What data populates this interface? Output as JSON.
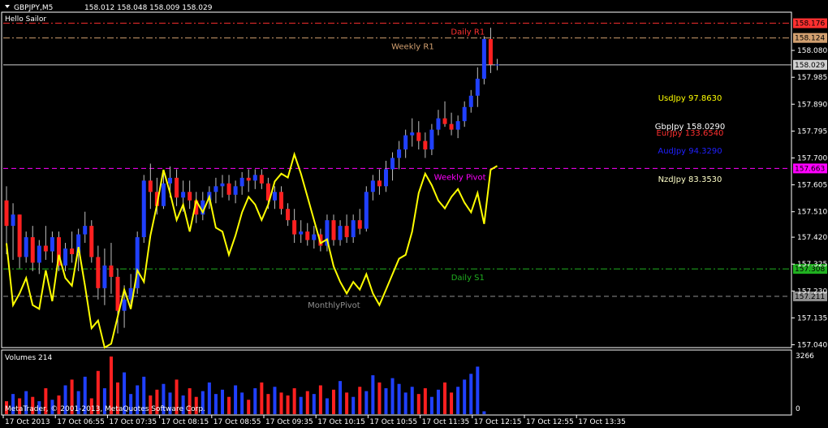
{
  "header": {
    "symbol": "GBPJPY,M5",
    "ohlc": "158.012 158.048 158.009 158.029",
    "comment": "Hello Sailor"
  },
  "volume_panel": {
    "title": "Volumes 214",
    "axis_top": "3266",
    "axis_bottom": "0",
    "copyright": "MetaTrader, © 2001-2013, MetaQuotes Software Corp."
  },
  "price_axis": {
    "ticks": [
      "158.080",
      "157.985",
      "157.890",
      "157.795",
      "157.700",
      "157.605",
      "157.510",
      "157.420",
      "157.325",
      "157.230",
      "157.135",
      "157.040"
    ],
    "ylim": [
      157.03,
      158.215
    ]
  },
  "time_axis": {
    "labels": [
      "17 Oct 2013",
      "17 Oct 06:55",
      "17 Oct 07:35",
      "17 Oct 08:15",
      "17 Oct 08:55",
      "17 Oct 09:35",
      "17 Oct 10:15",
      "17 Oct 10:55",
      "17 Oct 11:35",
      "17 Oct 12:15",
      "17 Oct 12:55",
      "17 Oct 13:35"
    ]
  },
  "levels": [
    {
      "name": "Daily R1",
      "price": 158.176,
      "label": "158.176",
      "color": "#ff3030",
      "style": "dashdot",
      "tag": "Daily R1",
      "tag_color": "#ff3030",
      "tag_pos": 0.59
    },
    {
      "name": "Weekly R1",
      "price": 158.124,
      "label": "158.124",
      "color": "#d2a070",
      "style": "dashdot",
      "tag": "Weekly R1",
      "tag_color": "#d2a070",
      "tag_pos": 0.52
    },
    {
      "name": "current",
      "price": 158.029,
      "label": "158.029",
      "color": "#d0d0d0",
      "style": "solid",
      "tag": "",
      "tag_color": "",
      "tag_pos": 0
    },
    {
      "name": "Weekly Pivot",
      "price": 157.663,
      "label": "157.663",
      "color": "#ff00ff",
      "style": "dashed",
      "tag": "Weekly Pivot",
      "tag_color": "#ff00ff",
      "tag_pos": 0.58
    },
    {
      "name": "Daily S1",
      "price": 157.308,
      "label": "157.308",
      "color": "#20b020",
      "style": "dashdot",
      "tag": "Daily S1",
      "tag_color": "#20b020",
      "tag_pos": 0.59
    },
    {
      "name": "MonthlyPivot",
      "price": 157.211,
      "label": "157.211",
      "color": "#909090",
      "style": "dashed",
      "tag": "MonthlyPivot",
      "tag_color": "#909090",
      "tag_pos": 0.42
    }
  ],
  "labels": [
    {
      "text": "UsdJpy 97.8630",
      "color": "#ffff00"
    },
    {
      "text": "GbpJpy 158.0290",
      "color": "#ffffff"
    },
    {
      "text": "EurJpy 133.6540",
      "color": "#ff3030"
    },
    {
      "text": "AudJpy 94.3290",
      "color": "#2020ff"
    },
    {
      "text": "NzdJpy 83.3530",
      "color": "#ffffc8"
    }
  ],
  "colors": {
    "bull": "#2040ff",
    "bear": "#ff2020",
    "wick": "#c0c0c0",
    "usdjpy_line": "#ffff00",
    "axis": "#ffffff"
  },
  "chart_data": {
    "type": "candlestick",
    "symbol": "GBPJPY,M5",
    "ylim": [
      157.03,
      158.215
    ],
    "candles": [
      [
        157.55,
        157.6,
        157.36,
        157.46
      ],
      [
        157.46,
        157.54,
        157.34,
        157.5
      ],
      [
        157.5,
        157.5,
        157.31,
        157.35
      ],
      [
        157.35,
        157.44,
        157.33,
        157.42
      ],
      [
        157.42,
        157.46,
        157.3,
        157.33
      ],
      [
        157.33,
        157.41,
        157.29,
        157.39
      ],
      [
        157.39,
        157.46,
        157.34,
        157.37
      ],
      [
        157.37,
        157.44,
        157.33,
        157.42
      ],
      [
        157.42,
        157.44,
        157.3,
        157.32
      ],
      [
        157.32,
        157.4,
        157.3,
        157.38
      ],
      [
        157.38,
        157.44,
        157.33,
        157.36
      ],
      [
        157.36,
        157.45,
        157.3,
        157.43
      ],
      [
        157.43,
        157.51,
        157.4,
        157.46
      ],
      [
        157.46,
        157.48,
        157.33,
        157.35
      ],
      [
        157.35,
        157.39,
        157.2,
        157.24
      ],
      [
        157.24,
        157.38,
        157.18,
        157.32
      ],
      [
        157.32,
        157.4,
        157.22,
        157.28
      ],
      [
        157.28,
        157.31,
        157.08,
        157.16
      ],
      [
        157.16,
        157.25,
        157.1,
        157.2
      ],
      [
        157.2,
        157.29,
        157.17,
        157.24
      ],
      [
        157.24,
        157.44,
        157.22,
        157.42
      ],
      [
        157.42,
        157.64,
        157.4,
        157.62
      ],
      [
        157.62,
        157.68,
        157.52,
        157.58
      ],
      [
        157.58,
        157.63,
        157.5,
        157.53
      ],
      [
        157.53,
        157.65,
        157.52,
        157.61
      ],
      [
        157.61,
        157.67,
        157.56,
        157.63
      ],
      [
        157.63,
        157.66,
        157.53,
        157.56
      ],
      [
        157.56,
        157.62,
        157.51,
        157.58
      ],
      [
        157.58,
        157.62,
        157.52,
        157.55
      ],
      [
        157.55,
        157.58,
        157.47,
        157.5
      ],
      [
        157.5,
        157.58,
        157.48,
        157.55
      ],
      [
        157.55,
        157.6,
        157.52,
        157.58
      ],
      [
        157.58,
        157.63,
        157.54,
        157.6
      ],
      [
        157.6,
        157.64,
        157.56,
        157.61
      ],
      [
        157.61,
        157.64,
        157.55,
        157.57
      ],
      [
        157.57,
        157.62,
        157.54,
        157.6
      ],
      [
        157.6,
        157.65,
        157.57,
        157.63
      ],
      [
        157.63,
        157.66,
        157.58,
        157.62
      ],
      [
        157.62,
        157.66,
        157.59,
        157.64
      ],
      [
        157.64,
        157.66,
        157.59,
        157.61
      ],
      [
        157.61,
        157.63,
        157.52,
        157.55
      ],
      [
        157.55,
        157.6,
        157.52,
        157.58
      ],
      [
        157.58,
        157.6,
        157.5,
        157.52
      ],
      [
        157.52,
        157.54,
        157.46,
        157.48
      ],
      [
        157.48,
        157.52,
        157.4,
        157.43
      ],
      [
        157.43,
        157.48,
        157.4,
        157.44
      ],
      [
        157.44,
        157.47,
        157.39,
        157.41
      ],
      [
        157.41,
        157.46,
        157.38,
        157.43
      ],
      [
        157.43,
        157.45,
        157.37,
        157.39
      ],
      [
        157.39,
        157.5,
        157.37,
        157.48
      ],
      [
        157.48,
        157.5,
        157.39,
        157.41
      ],
      [
        157.41,
        157.48,
        157.39,
        157.46
      ],
      [
        157.46,
        157.5,
        157.4,
        157.42
      ],
      [
        157.42,
        157.5,
        157.4,
        157.48
      ],
      [
        157.48,
        157.52,
        157.43,
        157.45
      ],
      [
        157.45,
        157.6,
        157.44,
        157.58
      ],
      [
        157.58,
        157.64,
        157.55,
        157.62
      ],
      [
        157.62,
        157.66,
        157.57,
        157.6
      ],
      [
        157.6,
        157.69,
        157.58,
        157.66
      ],
      [
        157.66,
        157.72,
        157.62,
        157.7
      ],
      [
        157.7,
        157.76,
        157.66,
        157.73
      ],
      [
        157.73,
        157.8,
        157.7,
        157.78
      ],
      [
        157.78,
        157.84,
        157.74,
        157.79
      ],
      [
        157.79,
        157.83,
        157.73,
        157.76
      ],
      [
        157.76,
        157.79,
        157.7,
        157.73
      ],
      [
        157.73,
        157.82,
        157.71,
        157.8
      ],
      [
        157.8,
        157.87,
        157.78,
        157.84
      ],
      [
        157.84,
        157.9,
        157.81,
        157.82
      ],
      [
        157.82,
        157.86,
        157.78,
        157.8
      ],
      [
        157.8,
        157.85,
        157.77,
        157.83
      ],
      [
        157.83,
        157.9,
        157.81,
        157.88
      ],
      [
        157.88,
        157.94,
        157.86,
        157.92
      ],
      [
        157.92,
        158.02,
        157.88,
        157.98
      ],
      [
        157.98,
        158.13,
        157.96,
        158.12
      ],
      [
        158.12,
        158.16,
        158.0,
        158.03
      ],
      [
        158.03,
        158.05,
        158.01,
        158.03
      ]
    ],
    "usdjpy_line": [
      [
        0,
        0.46
      ],
      [
        1,
        0.78
      ],
      [
        2,
        0.72
      ],
      [
        3,
        0.64
      ],
      [
        4,
        0.78
      ],
      [
        5,
        0.8
      ],
      [
        6,
        0.6
      ],
      [
        7,
        0.76
      ],
      [
        8,
        0.52
      ],
      [
        9,
        0.64
      ],
      [
        10,
        0.68
      ],
      [
        11,
        0.48
      ],
      [
        12,
        0.68
      ],
      [
        13,
        0.9
      ],
      [
        14,
        0.86
      ],
      [
        15,
        1.0
      ],
      [
        16,
        0.98
      ],
      [
        17,
        0.84
      ],
      [
        18,
        0.7
      ],
      [
        19,
        0.8
      ],
      [
        20,
        0.6
      ],
      [
        21,
        0.66
      ],
      [
        22,
        0.42
      ],
      [
        23,
        0.26
      ],
      [
        24,
        0.08
      ],
      [
        25,
        0.2
      ],
      [
        26,
        0.34
      ],
      [
        27,
        0.26
      ],
      [
        28,
        0.4
      ],
      [
        29,
        0.24
      ],
      [
        30,
        0.3
      ],
      [
        31,
        0.22
      ],
      [
        32,
        0.38
      ],
      [
        33,
        0.4
      ],
      [
        34,
        0.52
      ],
      [
        35,
        0.42
      ],
      [
        36,
        0.3
      ],
      [
        37,
        0.22
      ],
      [
        38,
        0.26
      ],
      [
        39,
        0.34
      ],
      [
        40,
        0.26
      ],
      [
        41,
        0.14
      ],
      [
        42,
        0.1
      ],
      [
        43,
        0.12
      ],
      [
        44,
        0.0
      ],
      [
        45,
        0.1
      ],
      [
        46,
        0.22
      ],
      [
        47,
        0.34
      ],
      [
        48,
        0.46
      ],
      [
        49,
        0.44
      ],
      [
        50,
        0.58
      ],
      [
        51,
        0.66
      ],
      [
        52,
        0.72
      ],
      [
        53,
        0.66
      ],
      [
        54,
        0.7
      ],
      [
        55,
        0.62
      ],
      [
        56,
        0.72
      ],
      [
        57,
        0.78
      ],
      [
        58,
        0.7
      ],
      [
        59,
        0.62
      ],
      [
        60,
        0.54
      ],
      [
        61,
        0.52
      ],
      [
        62,
        0.4
      ],
      [
        63,
        0.2
      ],
      [
        64,
        0.1
      ],
      [
        65,
        0.16
      ],
      [
        66,
        0.24
      ],
      [
        67,
        0.28
      ],
      [
        68,
        0.22
      ],
      [
        69,
        0.18
      ],
      [
        70,
        0.25
      ],
      [
        71,
        0.3
      ],
      [
        72,
        0.2
      ],
      [
        73,
        0.36
      ],
      [
        74,
        0.08
      ],
      [
        75,
        0.06
      ]
    ],
    "volumes": [
      9,
      14,
      11,
      16,
      12,
      9,
      18,
      10,
      13,
      20,
      24,
      16,
      26,
      11,
      30,
      18,
      40,
      22,
      29,
      14,
      20,
      26,
      13,
      17,
      21,
      15,
      24,
      13,
      18,
      12,
      16,
      22,
      14,
      17,
      12,
      20,
      15,
      10,
      18,
      22,
      14,
      19,
      15,
      13,
      18,
      12,
      16,
      14,
      20,
      11,
      17,
      23,
      15,
      12,
      19,
      16,
      27,
      22,
      18,
      25,
      21,
      15,
      19,
      14,
      18,
      12,
      17,
      22,
      15,
      19,
      24,
      28,
      33,
      2
    ]
  }
}
